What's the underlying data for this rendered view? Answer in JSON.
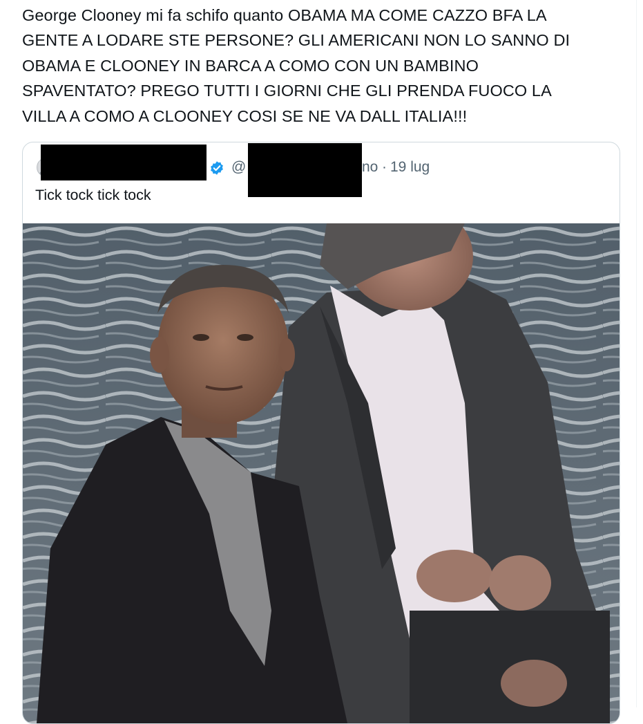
{
  "tweet": {
    "text": "George Clooney mi fa schifo quanto OBAMA MA COME CAZZO BFA LA\nGENTE A LODARE STE PERSONE? GLI AMERICANI NON LO SANNO DI\nOBAMA E CLOONEY IN BARCA A COMO CON UN BAMBINO\nSPAVENTATO? PREGO TUTTI I GIORNI CHE GLI PRENDA FUOCO LA\nVILLA A COMO A CLOONEY COSI SE NE VA DALL ITALIA!!!"
  },
  "quoted_tweet": {
    "handle_prefix": "@",
    "handle_suffix": "no",
    "separator": "·",
    "date": "19 lug",
    "text": "Tick tock tick tock",
    "verified_icon": "verified-badge-icon",
    "verified_color": "#1d9bf0",
    "redaction_color": "#000000"
  }
}
